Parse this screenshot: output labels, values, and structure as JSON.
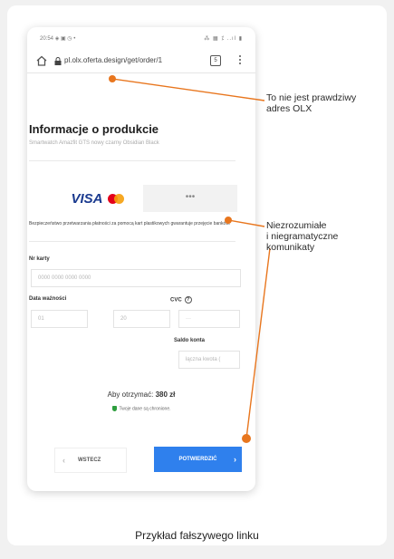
{
  "phone": {
    "status_time": "20:54",
    "status_icons": "◈ ▣ ◷ •",
    "status_signal": "⁂ ▦ ⁒ ..ıl ▮",
    "url": "pl.olx.oferta.design/get/order/1",
    "tab_count": "5"
  },
  "product": {
    "title": "Informacje o produkcie",
    "subtitle": "Smartwatch Amazfit GTS nowy czarny Obsidian Black"
  },
  "payment": {
    "visa_label": "VISA",
    "other_methods": "•••",
    "secure_text": "Bezpieczeństwo przetwarzania płatności za pomocą kart plastikowych gwarantuje przejęcie banków."
  },
  "form": {
    "card_label": "Nr karty",
    "card_placeholder": "0000 0000 0000 0000",
    "expiry_label": "Data ważności",
    "month_placeholder": "01",
    "year_placeholder": "20",
    "cvc_label": "CVC",
    "cvc_placeholder": "···",
    "balance_label": "Saldo konta",
    "balance_placeholder": "łączna kwota ("
  },
  "summary": {
    "receive_label": "Aby otrzymać:",
    "receive_amount": "380 zł",
    "protected_text": "Twoje dane są chronione."
  },
  "buttons": {
    "back_label": "WSTECZ",
    "confirm_label": "POTWIERDZIĆ"
  },
  "annotations": {
    "url_note_line1": "To nie jest prawdziwy",
    "url_note_line2": "adres OLX",
    "msg_note_line1": "Niezrozumiałe",
    "msg_note_line2": "i niegramatyczne",
    "msg_note_line3": "komunikaty"
  },
  "caption": "Przykład fałszywego linku",
  "colors": {
    "accent_orange": "#e8761e",
    "confirm_blue": "#2f80ed",
    "visa_blue": "#1a3a8f"
  }
}
